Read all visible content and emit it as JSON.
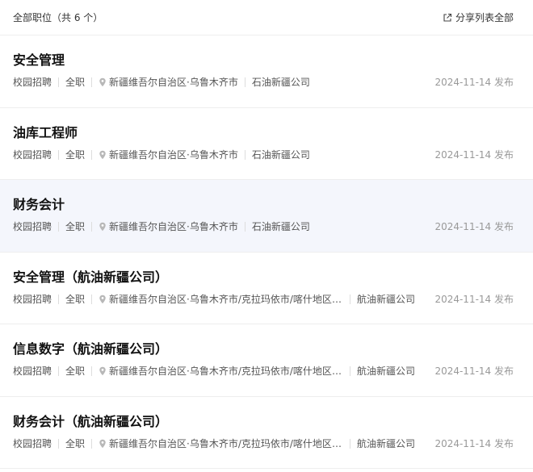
{
  "header": {
    "title": "全部职位（共 6 个）",
    "share_label": "分享列表全部"
  },
  "jobs": [
    {
      "title": "安全管理",
      "recruit_type": "校园招聘",
      "job_type": "全职",
      "location": "新疆维吾尔自治区·乌鲁木齐市",
      "company": "石油新疆公司",
      "date": "2024-11-14 发布"
    },
    {
      "title": "油库工程师",
      "recruit_type": "校园招聘",
      "job_type": "全职",
      "location": "新疆维吾尔自治区·乌鲁木齐市",
      "company": "石油新疆公司",
      "date": "2024-11-14 发布"
    },
    {
      "title": "财务会计",
      "recruit_type": "校园招聘",
      "job_type": "全职",
      "location": "新疆维吾尔自治区·乌鲁木齐市",
      "company": "石油新疆公司",
      "date": "2024-11-14 发布"
    },
    {
      "title": "安全管理（航油新疆公司）",
      "recruit_type": "校园招聘",
      "job_type": "全职",
      "location": "新疆维吾尔自治区·乌鲁木齐市/克拉玛依市/喀什地区,新...",
      "company": "航油新疆公司",
      "date": "2024-11-14 发布"
    },
    {
      "title": "信息数字（航油新疆公司）",
      "recruit_type": "校园招聘",
      "job_type": "全职",
      "location": "新疆维吾尔自治区·乌鲁木齐市/克拉玛依市/喀什地区,新...",
      "company": "航油新疆公司",
      "date": "2024-11-14 发布"
    },
    {
      "title": "财务会计（航油新疆公司）",
      "recruit_type": "校园招聘",
      "job_type": "全职",
      "location": "新疆维吾尔自治区·乌鲁木齐市/克拉玛依市/喀什地区,新...",
      "company": "航油新疆公司",
      "date": "2024-11-14 发布"
    }
  ],
  "icons": {
    "share": "share-icon",
    "location": "location-pin-icon"
  },
  "colors": {
    "highlight_bg": "#f4f6fc",
    "date": "#999999"
  }
}
